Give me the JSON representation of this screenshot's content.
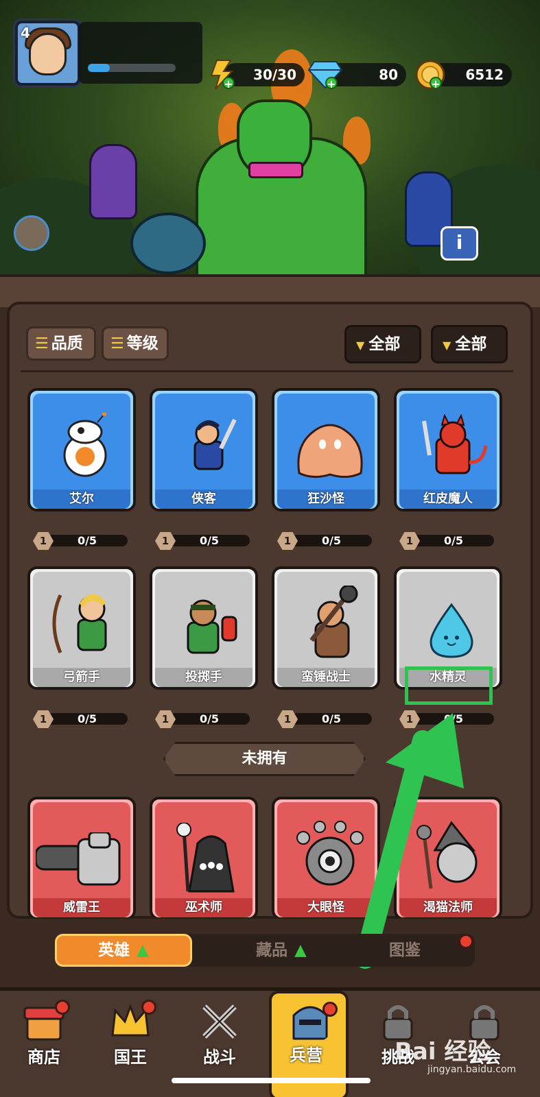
{
  "player": {
    "level": "4",
    "xp_progress": 0.25
  },
  "resources": {
    "energy": "30/30",
    "gems": "80",
    "gold": "6512"
  },
  "filters": {
    "quality_label": "品质",
    "level_label": "等级",
    "dropdown_1": "全部",
    "dropdown_2": "全部"
  },
  "owned_heroes": [
    {
      "name": "艾尔",
      "level": "1",
      "shards": "0/5",
      "rarity": "blue"
    },
    {
      "name": "侠客",
      "level": "1",
      "shards": "0/5",
      "rarity": "blue"
    },
    {
      "name": "狂沙怪",
      "level": "1",
      "shards": "0/5",
      "rarity": "blue"
    },
    {
      "name": "红皮魔人",
      "level": "1",
      "shards": "0/5",
      "rarity": "blue"
    },
    {
      "name": "弓箭手",
      "level": "1",
      "shards": "0/5",
      "rarity": "grey"
    },
    {
      "name": "投掷手",
      "level": "1",
      "shards": "0/5",
      "rarity": "grey"
    },
    {
      "name": "蛮锤战士",
      "level": "1",
      "shards": "0/5",
      "rarity": "grey"
    },
    {
      "name": "水精灵",
      "level": "1",
      "shards": "0/5",
      "rarity": "grey"
    }
  ],
  "not_owned_label": "未拥有",
  "unowned_heroes": [
    {
      "name": "威雷王"
    },
    {
      "name": "巫术师"
    },
    {
      "name": "大眼怪"
    },
    {
      "name": "渴猫法师"
    }
  ],
  "tabs": {
    "heroes": "英雄",
    "collection": "藏品",
    "codex": "图鉴"
  },
  "nav": {
    "shop": "商店",
    "king": "国王",
    "battle": "战斗",
    "barracks": "兵营",
    "challenge": "挑战",
    "guild": "公会"
  },
  "watermark": {
    "brand": "Bai 经验",
    "url": "jingyan.baidu.com"
  },
  "colors": {
    "highlight": "#2fc452",
    "accent_orange": "#f08a2a",
    "rare_blue": "#3d8ee8",
    "common_grey": "#c9c9c9",
    "locked_red": "#e25a5a"
  }
}
